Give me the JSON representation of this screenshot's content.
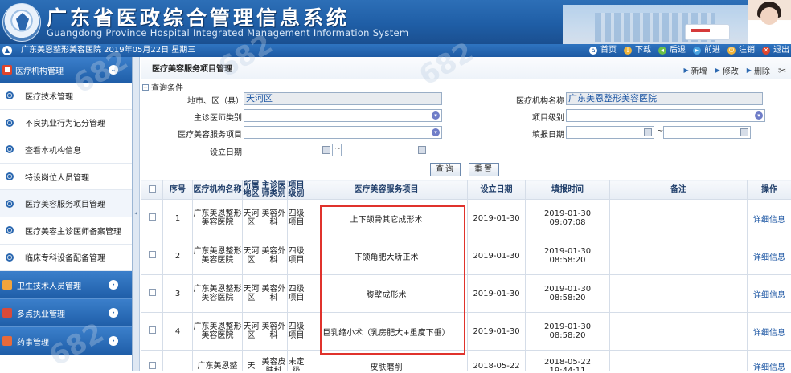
{
  "banner": {
    "title_cn": "广东省医政综合管理信息系统",
    "title_en": "Guangdong Province Hospital Integrated Management Information System"
  },
  "topbar": {
    "info": "广东美恩整形美容医院 2019年05月22日 星期三",
    "nav": [
      {
        "label": "首页",
        "icon": "home-icon",
        "color": "#ffffff"
      },
      {
        "label": "下载",
        "icon": "download-icon",
        "color": "#f0b43a"
      },
      {
        "label": "后退",
        "icon": "back-icon",
        "color": "#6cc04a"
      },
      {
        "label": "前进",
        "icon": "forward-icon",
        "color": "#4aa3e0"
      },
      {
        "label": "注销",
        "icon": "logout-icon",
        "color": "#f0b43a"
      },
      {
        "label": "退出",
        "icon": "exit-icon",
        "color": "#e0442b"
      }
    ]
  },
  "sidebar": {
    "header": "医疗机构管理",
    "items": [
      {
        "label": "医疗技术管理"
      },
      {
        "label": "不良执业行为记分管理"
      },
      {
        "label": "查看本机构信息"
      },
      {
        "label": "特设岗位人员管理"
      },
      {
        "label": "医疗美容服务项目管理"
      },
      {
        "label": "医疗美容主诊医师备案管理"
      },
      {
        "label": "临床专科设备配备管理"
      }
    ],
    "groups": [
      {
        "label": "卫生技术人员管理",
        "icon": "staff-icon",
        "color": "#f3a43b"
      },
      {
        "label": "多点执业管理",
        "icon": "multi-site-icon",
        "color": "#d94a3a"
      },
      {
        "label": "药事管理",
        "icon": "pharmacy-icon",
        "color": "#e86a3a"
      }
    ]
  },
  "main": {
    "title": "医疗美容服务项目管理",
    "actions": [
      "新增",
      "修改",
      "删除"
    ]
  },
  "query": {
    "section_label": "查询条件",
    "district_label": "地市、区（县）",
    "district_value": "天河区",
    "org_label": "医疗机构名称",
    "org_value": "广东美恩整形美容医院",
    "dept_label": "主诊医师类别",
    "level_label": "项目级别",
    "service_label": "医疗美容服务项目",
    "report_date_label": "填报日期",
    "setup_date_label": "设立日期",
    "tilde": "~",
    "search_button": "查询",
    "reset_button": "重置"
  },
  "table": {
    "columns": [
      "序号",
      "医疗机构名称",
      "所属地区",
      "主诊医师类别",
      "项目级别",
      "医疗美容服务项目",
      "设立日期",
      "填报时间",
      "备注",
      "操作"
    ],
    "rows": [
      {
        "no": "1",
        "org": "广东美恩整形美容医院",
        "area": "天河区",
        "dept": "美容外科",
        "level": "四级项目",
        "service": "上下颌骨其它成形术",
        "setup": "2019-01-30",
        "report": "2019-01-30 09:07:08",
        "note": "",
        "op": "详细信息"
      },
      {
        "no": "2",
        "org": "广东美恩整形美容医院",
        "area": "天河区",
        "dept": "美容外科",
        "level": "四级项目",
        "service": "下颌角肥大矫正术",
        "setup": "2019-01-30",
        "report": "2019-01-30 08:58:20",
        "note": "",
        "op": "详细信息"
      },
      {
        "no": "3",
        "org": "广东美恩整形美容医院",
        "area": "天河区",
        "dept": "美容外科",
        "level": "四级项目",
        "service": "腹壁成形术",
        "setup": "2019-01-30",
        "report": "2019-01-30 08:58:20",
        "note": "",
        "op": "详细信息"
      },
      {
        "no": "4",
        "org": "广东美恩整形美容医院",
        "area": "天河区",
        "dept": "美容外科",
        "level": "四级项目",
        "service": "巨乳缩小术（乳房肥大+重度下垂）",
        "setup": "2019-01-30",
        "report": "2019-01-30 08:58:20",
        "note": "",
        "op": "详细信息"
      },
      {
        "no": "",
        "org": "广东美恩整",
        "area": "天",
        "dept": "美容皮肤科",
        "level": "未定级",
        "service": "皮肤磨削",
        "setup": "2018-05-22",
        "report": "2018-05-22 19:44:11",
        "note": "",
        "op": "详细信息"
      }
    ]
  },
  "watermark": "682"
}
